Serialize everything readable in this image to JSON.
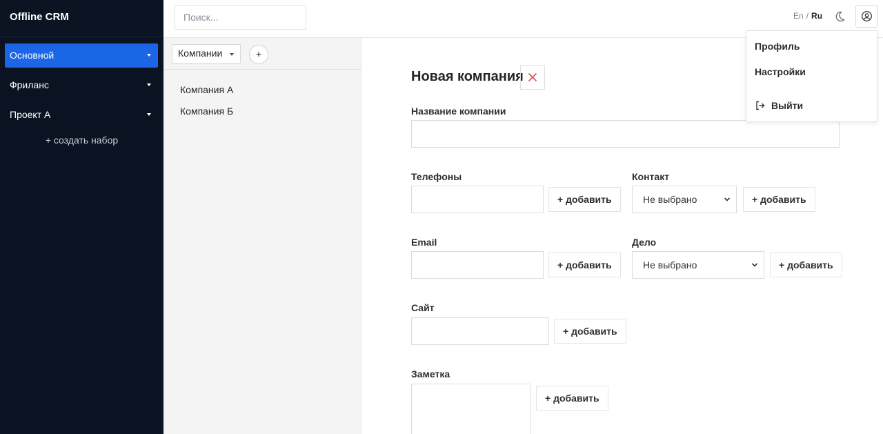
{
  "app": {
    "title": "Offline CRM"
  },
  "sidebar": {
    "items": [
      {
        "label": "Основной",
        "active": true
      },
      {
        "label": "Фриланс",
        "active": false
      },
      {
        "label": "Проект А",
        "active": false
      }
    ],
    "create_set": "+ создать набор"
  },
  "header": {
    "search_placeholder": "Поиск...",
    "lang_en": "En",
    "lang_sep": "/",
    "lang_ru": "Ru"
  },
  "list": {
    "entity": "Компании",
    "add_label": "+",
    "items": [
      "Компания А",
      "Компания Б"
    ]
  },
  "form": {
    "title": "Новая компания",
    "name_label": "Название компании",
    "phones_label": "Телефоны",
    "contact_label": "Контакт",
    "contact_value": "Не выбрано",
    "email_label": "Email",
    "case_label": "Дело",
    "case_value": "Не выбрано",
    "site_label": "Сайт",
    "note_label": "Заметка",
    "add_label": "+ добавить"
  },
  "user_menu": {
    "profile": "Профиль",
    "settings": "Настройки",
    "logout": "Выйти"
  },
  "colors": {
    "sidebar_bg": "#0b1221",
    "accent": "#1a66e6",
    "close_icon": "#d9534f"
  }
}
